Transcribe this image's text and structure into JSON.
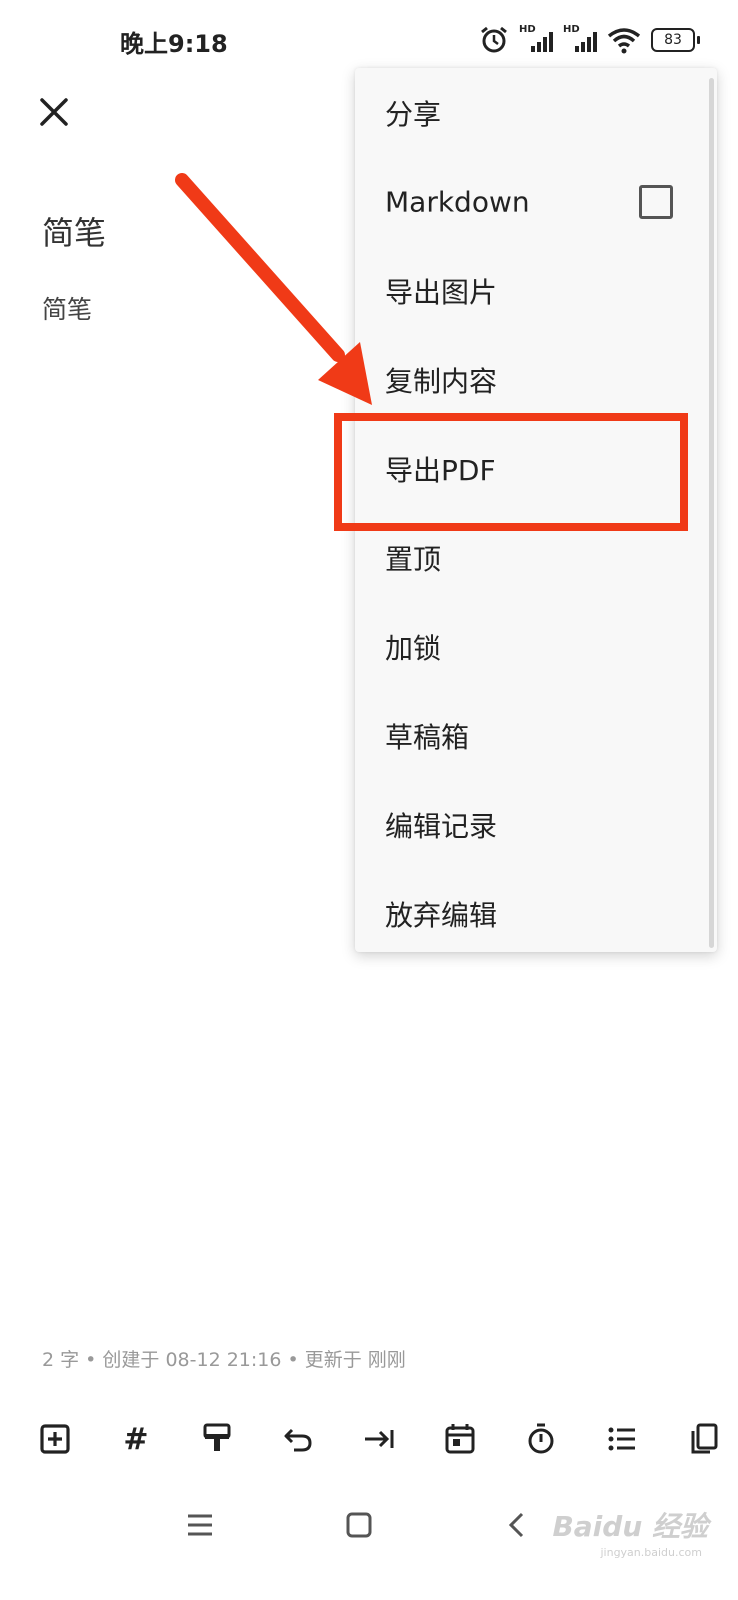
{
  "status_bar": {
    "time": "晚上9:18",
    "battery": "83",
    "signal_label": "HD"
  },
  "note": {
    "title": "简笔",
    "body": "简笔"
  },
  "menu": {
    "items": [
      {
        "label": "分享"
      },
      {
        "label": "Markdown",
        "checkbox": false
      },
      {
        "label": "导出图片"
      },
      {
        "label": "复制内容"
      },
      {
        "label": "导出PDF",
        "highlighted": true
      },
      {
        "label": "置顶"
      },
      {
        "label": "加锁"
      },
      {
        "label": "草稿箱"
      },
      {
        "label": "编辑记录"
      },
      {
        "label": "放弃编辑"
      }
    ]
  },
  "meta": "2 字 • 创建于 08-12 21:16 • 更新于 刚刚",
  "toolbar": {
    "hash_label": "#",
    "icons": [
      "add-box-icon",
      "hashtag-icon",
      "format-paint-icon",
      "undo-icon",
      "indent-icon",
      "calendar-icon",
      "timer-icon",
      "list-icon",
      "copy-icon"
    ]
  },
  "nav_icons": [
    "menu-icon",
    "home-icon",
    "back-icon"
  ],
  "annotation": {
    "color": "#f03a17"
  },
  "watermark": {
    "brand": "Baidu 经验",
    "url": "jingyan.baidu.com"
  }
}
